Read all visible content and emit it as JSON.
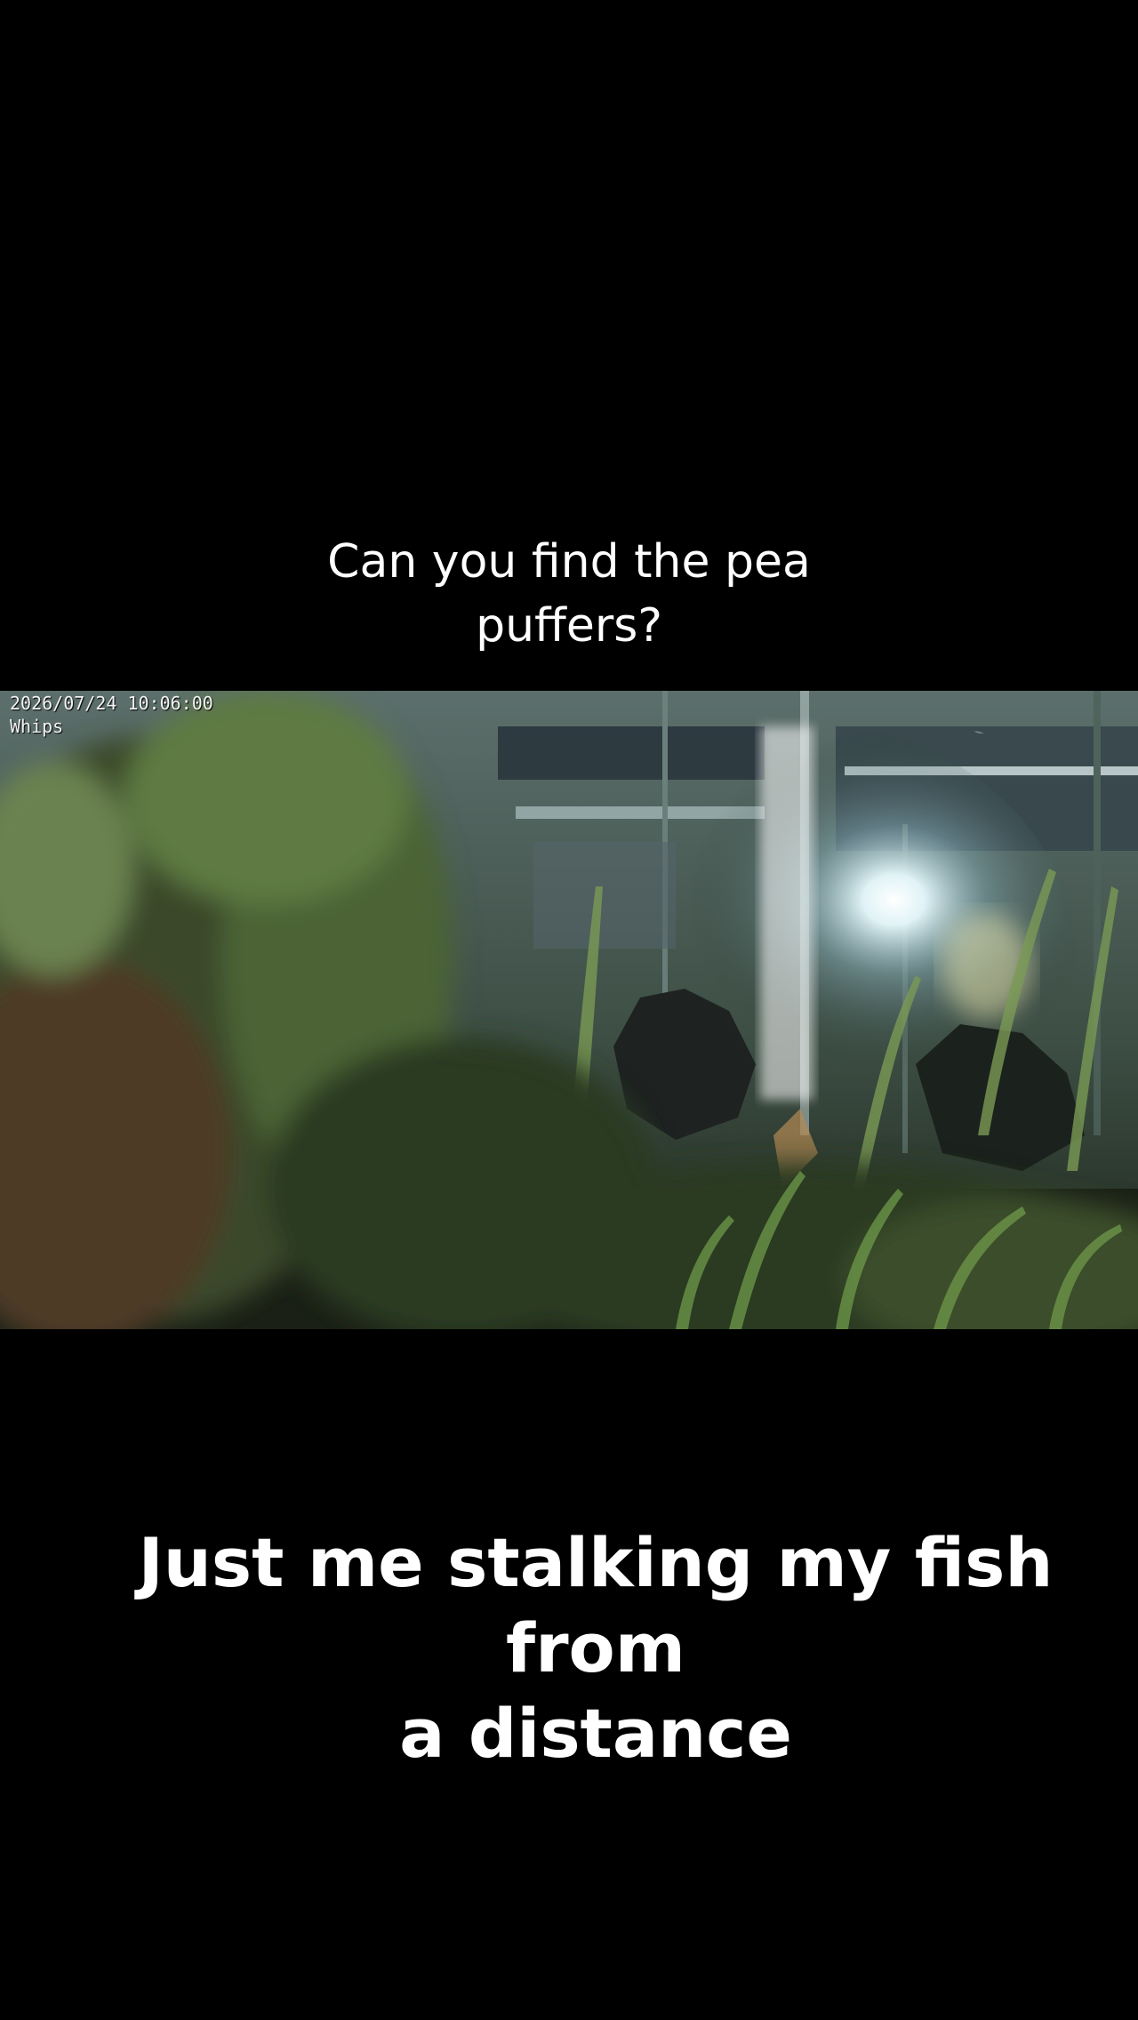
{
  "top_caption": {
    "line1": "Can you find  the pea",
    "line2": "puffers?"
  },
  "camera_overlay": {
    "timestamp": "2026/07/24 10:06:00",
    "camera_name": "Whips"
  },
  "bottom_caption": {
    "line1": "Just me stalking my fish from",
    "line2": "a distance"
  },
  "colors": {
    "background": "#000000",
    "caption_text": "#ffffff",
    "plant_green": "#3f5a2e",
    "glow": "#e8f8ff"
  }
}
